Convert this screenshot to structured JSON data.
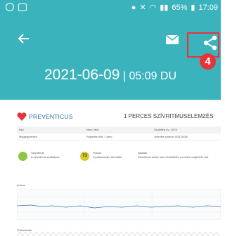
{
  "statusbar": {
    "battery": "65%",
    "time": "17:09"
  },
  "header": {
    "date": "2021-06-09",
    "separator": "|",
    "time": "05:09 DU"
  },
  "annotation": {
    "step": "4"
  },
  "report": {
    "brand": "PREVENTICUS",
    "title": "1 PERCES SZÍVRITMUSELEMZÉS",
    "rows": [
      [
        "Név",
        "Nem: férfi",
        "Születési év: 1974"
      ],
      [
        "Megjegyzések",
        "Rögzítési idő: 1 perc",
        "Jelentés száma: 00/12/456"
      ]
    ],
    "results": [
      {
        "label": "Szívritmus",
        "text": "A szívritmus szabályos"
      },
      {
        "value": "73",
        "label": "Pulzus",
        "text": "A pulzusszám normális"
      },
      {
        "label": "Ajánlás",
        "text": "Szívritmus zavar nem észlelhető, a mérés megfelelő volt."
      }
    ],
    "ecg_label": "pulzus",
    "ecg2_label": "Pulzusszám"
  },
  "colors": {
    "teal": "#3bb3bd",
    "annotation_red": "#e8323a"
  }
}
